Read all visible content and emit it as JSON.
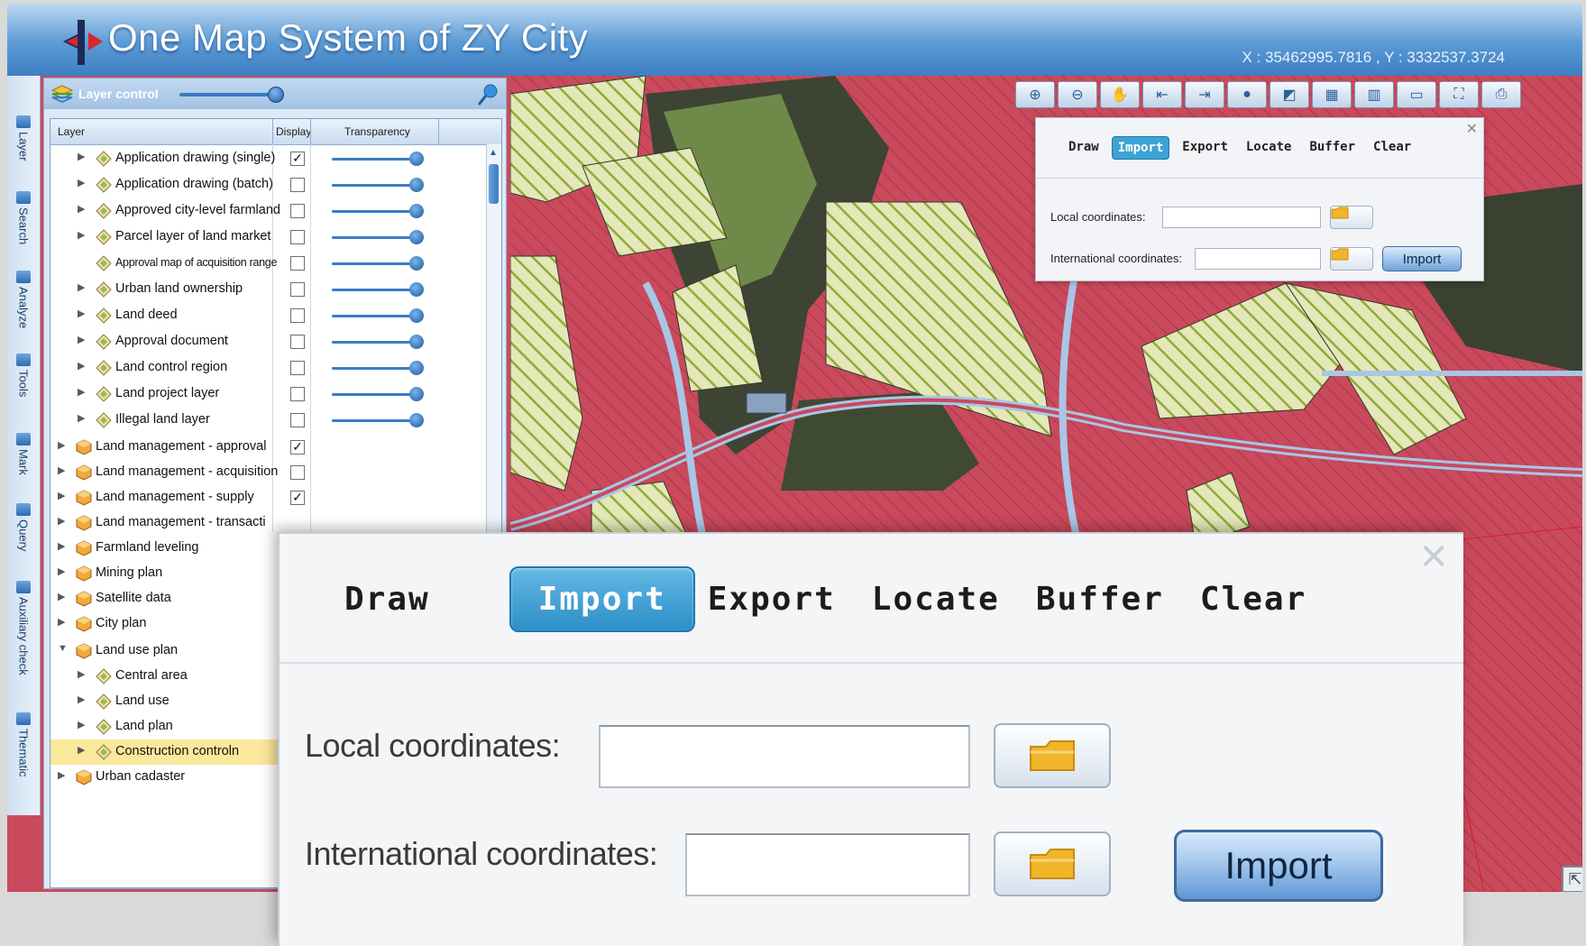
{
  "app": {
    "title": "One Map System of ZY City",
    "coordinates": "X : 35462995.7816 , Y : 3332537.3724"
  },
  "tool_strip": [
    {
      "label": "Layer",
      "icon": "layer-icon"
    },
    {
      "label": "Search",
      "icon": "search-icon"
    },
    {
      "label": "Analyze",
      "icon": "analyze-icon"
    },
    {
      "label": "Tools",
      "icon": "tools-icon"
    },
    {
      "label": "Mark",
      "icon": "mark-icon"
    },
    {
      "label": "Query",
      "icon": "query-icon"
    },
    {
      "label": "Auxiliary check",
      "icon": "auxiliary-check-icon"
    },
    {
      "label": "Thematic",
      "icon": "thematic-icon"
    }
  ],
  "layer_panel": {
    "title": "Layer control",
    "columns": {
      "layer": "Layer",
      "display": "Display",
      "transparency": "Transparency"
    },
    "rows": [
      {
        "label": "Application drawing (single)",
        "checked": "✓"
      },
      {
        "label": "Application drawing (batch)",
        "checked": ""
      },
      {
        "label": "Approved city-level farmland",
        "checked": ""
      },
      {
        "label": "Parcel layer of land market",
        "checked": ""
      },
      {
        "label": "Approval map of acquisition range",
        "checked": ""
      },
      {
        "label": "Urban land ownership",
        "checked": ""
      },
      {
        "label": "Land deed",
        "checked": ""
      },
      {
        "label": "Approval document",
        "checked": ""
      },
      {
        "label": "Land control region",
        "checked": ""
      },
      {
        "label": "Land project layer",
        "checked": ""
      },
      {
        "label": "Illegal land layer",
        "checked": ""
      },
      {
        "label": "Land management - approval",
        "checked": "✓"
      },
      {
        "label": "Land management - acquisition",
        "checked": ""
      },
      {
        "label": "Land management - supply",
        "checked": "✓"
      },
      {
        "label": "Land management - transacti"
      },
      {
        "label": "Farmland leveling"
      },
      {
        "label": "Mining plan"
      },
      {
        "label": "Satellite data"
      },
      {
        "label": "City plan"
      },
      {
        "label": "Land use plan"
      },
      {
        "label": "Central area"
      },
      {
        "label": "Land use"
      },
      {
        "label": "Land plan"
      },
      {
        "label": "Construction controln"
      },
      {
        "label": "Urban cadaster"
      }
    ]
  },
  "map_toolbar": [
    "zoom-in-icon",
    "zoom-out-icon",
    "pan-hand-icon",
    "previous-extent-icon",
    "next-extent-icon",
    "globe-icon",
    "measure-icon",
    "film-icon",
    "book-icon",
    "screen-icon",
    "full-extent-icon",
    "print-icon"
  ],
  "import_popup": {
    "tabs": [
      "Draw",
      "Import",
      "Export",
      "Locate",
      "Buffer",
      "Clear"
    ],
    "active_tab": "Import",
    "local_label": "Local coordinates:",
    "international_label": "International coordinates:",
    "import_button": "Import",
    "close": "✕"
  },
  "colors": {
    "title_bar": "#4f90cf",
    "map_fill": "#c84a5c",
    "hatch": "#8faa3a",
    "active_tab": "#3ca3d6"
  }
}
